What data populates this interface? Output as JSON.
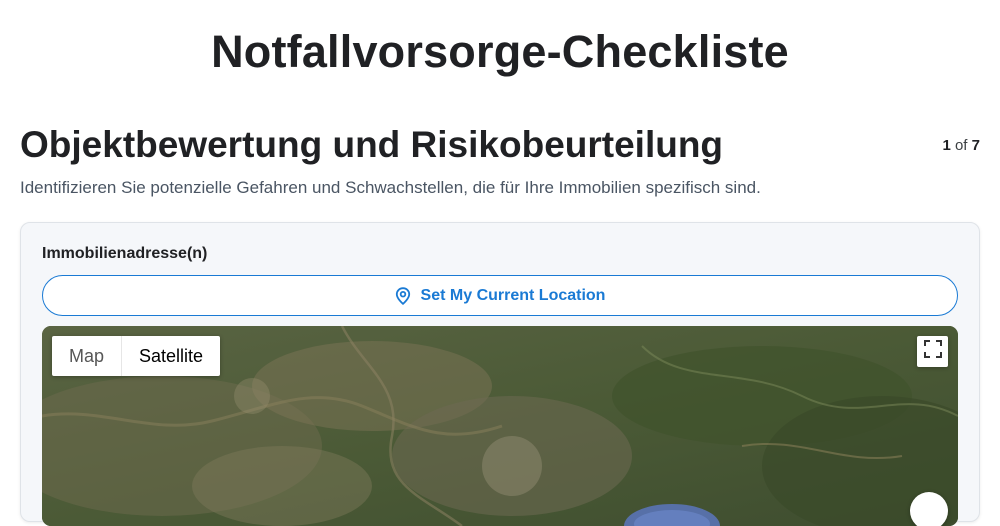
{
  "page": {
    "title": "Notfallvorsorge-Checkliste"
  },
  "section": {
    "title": "Objektbewertung und Risikobeurteilung",
    "description": "Identifizieren Sie potenzielle Gefahren und Schwachstellen, die für Ihre Immobilien spezifisch sind.",
    "pager": {
      "current": "1",
      "separator": "of",
      "total": "7"
    }
  },
  "form": {
    "address_label": "Immobilienadresse(n)",
    "location_button_label": "Set My Current Location",
    "location_icon": "map-pin-icon"
  },
  "map": {
    "type_options": [
      {
        "label": "Map",
        "active": false
      },
      {
        "label": "Satellite",
        "active": true
      }
    ],
    "fullscreen_icon": "fullscreen-icon"
  },
  "colors": {
    "accent": "#1a7ad4",
    "card_background": "#f5f7fa"
  }
}
